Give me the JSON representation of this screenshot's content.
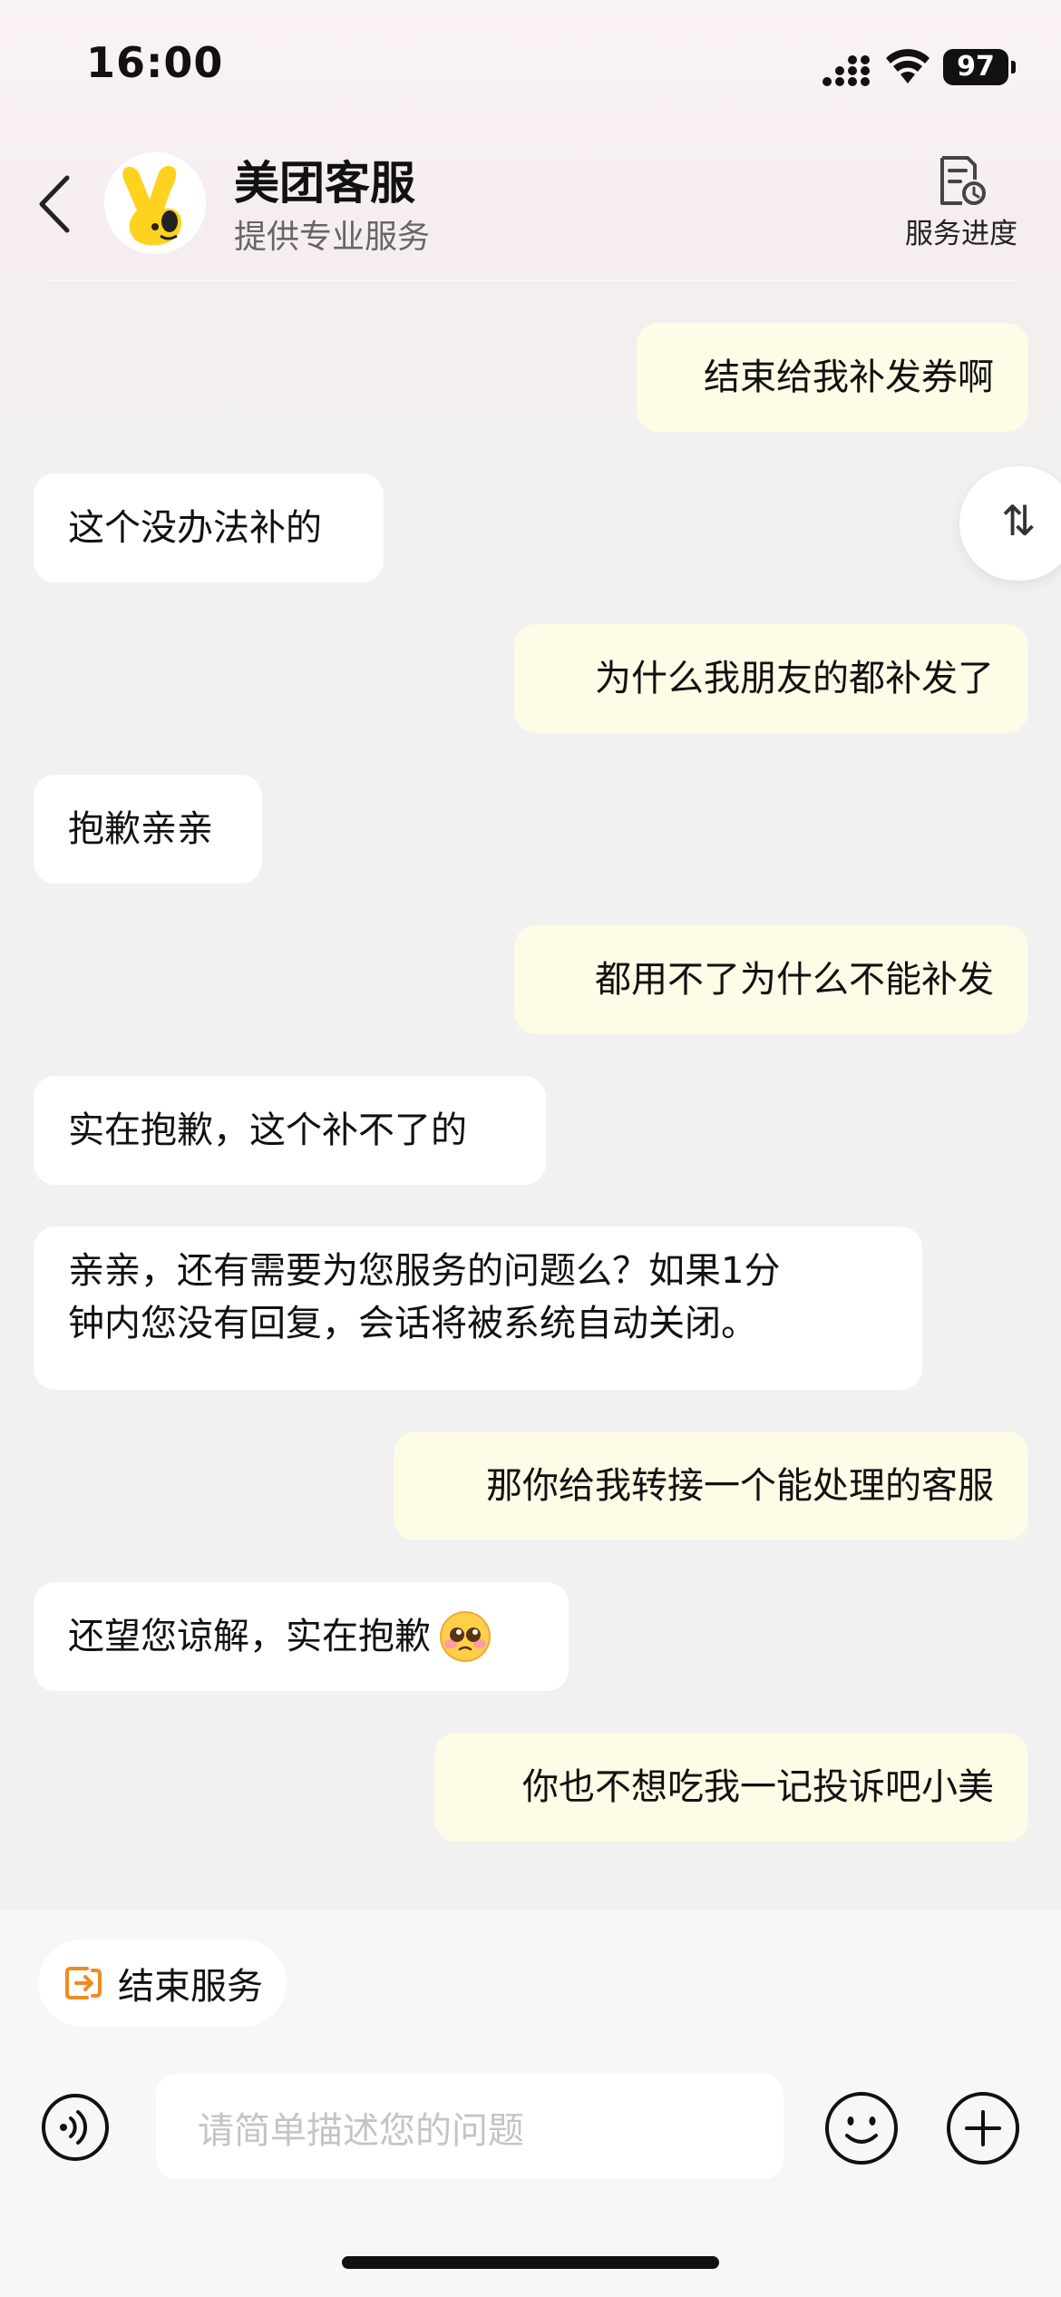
{
  "status_bar": {
    "time": "16:00",
    "battery": "97"
  },
  "header": {
    "title": "美团客服",
    "subtitle": "提供专业服务",
    "progress_label": "服务进度"
  },
  "messages": [
    {
      "side": "out",
      "text": "结束给我补发券啊"
    },
    {
      "side": "in",
      "text": "这个没办法补的"
    },
    {
      "side": "out",
      "text": "为什么我朋友的都补发了"
    },
    {
      "side": "in",
      "text": "抱歉亲亲"
    },
    {
      "side": "out",
      "text": "都用不了为什么不能补发"
    },
    {
      "side": "in",
      "text": "实在抱歉，这个补不了的"
    },
    {
      "side": "in",
      "text_line1": "亲亲，还有需要为您服务的问题么？如果1分",
      "text_line2": "钟内您没有回复，会话将被系统自动关闭。"
    },
    {
      "side": "out",
      "text": "那你给我转接一个能处理的客服"
    },
    {
      "side": "in",
      "text": "还望您谅解，实在抱歉",
      "emoji": "pleading-face-emoji"
    },
    {
      "side": "out",
      "text": "你也不想吃我一记投诉吧小美"
    }
  ],
  "scroll_toggle": "⇅",
  "end_service_label": "结束服务",
  "input": {
    "placeholder": "请简单描述您的问题"
  },
  "icons": {
    "back": "chevron-left-icon",
    "progress": "document-clock-icon",
    "end_service": "exit-icon",
    "voice": "voice-icon",
    "emoji": "smiley-icon",
    "plus": "plus-icon"
  },
  "colors": {
    "outgoing_bubble": "#fefbe6",
    "incoming_bubble": "#ffffff",
    "accent": "#f08a24",
    "brand_yellow": "#ffd21f"
  }
}
